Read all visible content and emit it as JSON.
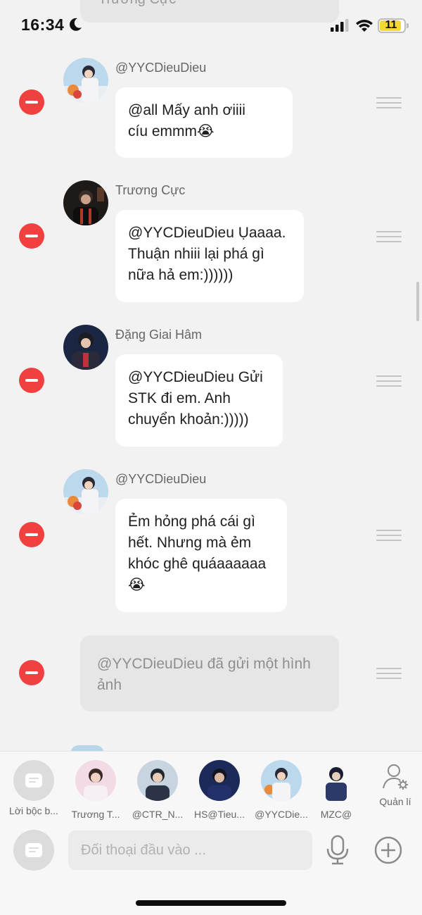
{
  "status_bar": {
    "time": "16:34",
    "battery": "11"
  },
  "top_partial": {
    "text": "Trương Cực"
  },
  "messages": [
    {
      "sender": "@YYCDieuDieu",
      "text_lines": [
        "@all Mấy anh ơiiii",
        "cíu emmm😭"
      ]
    },
    {
      "sender": "Trương Cực",
      "text_lines": [
        "@YYCDieuDieu Ụaaaa.",
        "Thuận nhiii lại phá gì",
        "nữa hả em:))))))"
      ]
    },
    {
      "sender": "Đặng Giai Hâm",
      "text_lines": [
        "@YYCDieuDieu Gửi",
        "STK đi em. Anh",
        "chuyển khoản:)))))"
      ]
    },
    {
      "sender": "@YYCDieuDieu",
      "text_lines": [
        "Ẻm hỏng phá cái gì",
        "hết. Nhưng mà ẻm",
        "khóc ghê quáaaaaaa",
        "😭"
      ]
    }
  ],
  "system_message": {
    "text": "@YYCDieuDieu đã gửi một hình ảnh"
  },
  "bottom": {
    "chips": [
      {
        "label": "Lời bộc b..."
      },
      {
        "label": "Trương T..."
      },
      {
        "label": "@CTR_N..."
      },
      {
        "label": "HS@Tieu..."
      },
      {
        "label": "@YYCDie..."
      },
      {
        "label": "MZC@"
      }
    ],
    "manage_label": "Quản lí",
    "input_placeholder": "Đối thoại đầu vào ..."
  },
  "colors": {
    "delete": "#f04040",
    "background": "#f2f2f2",
    "bubble": "#ffffff",
    "system_bubble": "#e6e6e6"
  }
}
